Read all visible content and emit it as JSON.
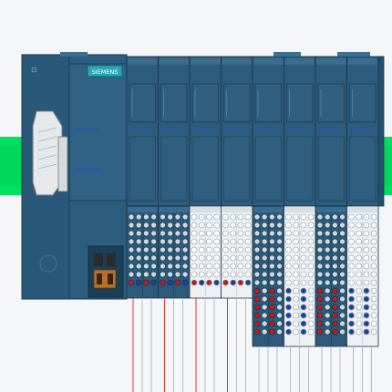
{
  "brand": "SIEMENS",
  "station_labels": {
    "cpu_top": "-PA4-U9A-1",
    "cpu_bottom": "-PA1-U1A-K3"
  },
  "module_ids": [
    "-PA4-U9A-2",
    "-PA1-U9A-3",
    "-PA1-U9A-4",
    "-PA1-U9A-5",
    "-PA1-U9A-6",
    "-PA1-U9A-7",
    "-PA1-U9A-8",
    "-PA1-U9A-9"
  ],
  "colors": {
    "module": "#2d5d7e",
    "module_dark": "#1e445e",
    "rail": "#00e060",
    "brand_box": "#2aa6b6",
    "label_blue": "#1b4fd8",
    "wire_red": "#e31a1a",
    "wire_gray": "#b0b4b8"
  },
  "terminal_blocks": [
    {
      "style": "dark"
    },
    {
      "style": "dark"
    },
    {
      "style": "light"
    },
    {
      "style": "light"
    },
    {
      "style": "dark"
    },
    {
      "style": "light"
    },
    {
      "style": "dark"
    },
    {
      "style": "light"
    }
  ]
}
